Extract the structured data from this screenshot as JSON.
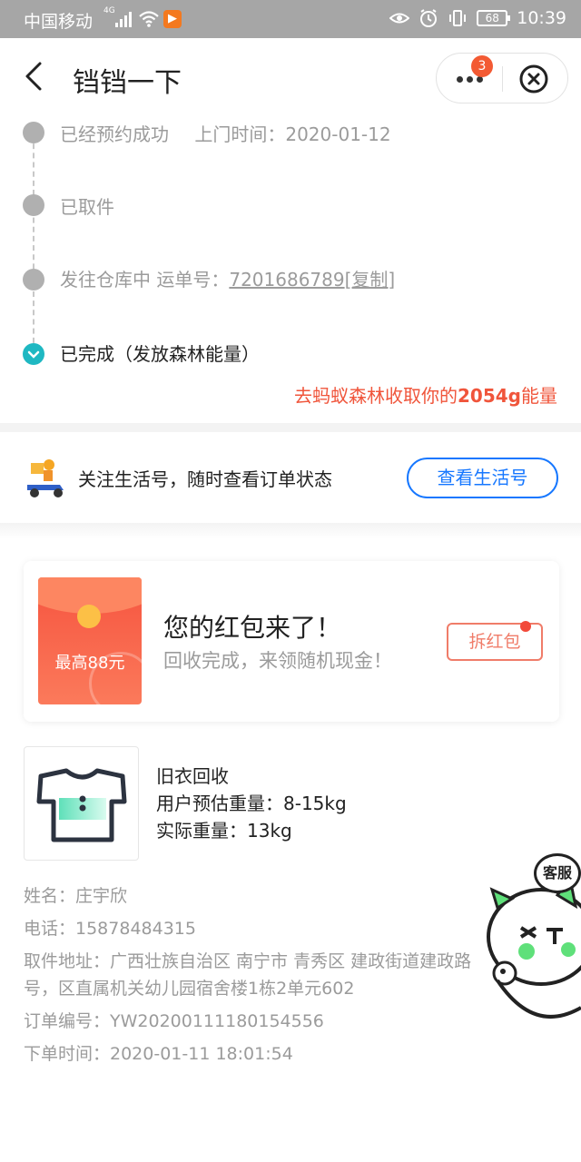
{
  "status_bar": {
    "carrier": "中国移动",
    "network": "4G",
    "battery": "68",
    "time": "10:39"
  },
  "header": {
    "title": "铛铛一下",
    "notification_count": "3"
  },
  "timeline": {
    "steps": [
      {
        "label": "已经预约成功",
        "detail": "上门时间：2020-01-12"
      },
      {
        "label": "已取件"
      },
      {
        "label": "发往仓库中 运单号：",
        "tracking_no": "7201686789",
        "copy_label": "[复制]"
      },
      {
        "label": "已完成（发放森林能量）"
      }
    ],
    "energy_prefix": "去蚂蚁森林收取你的",
    "energy_amount": "2054g",
    "energy_suffix": "能量"
  },
  "follow": {
    "text": "关注生活号，随时查看订单状态",
    "button": "查看生活号"
  },
  "red_packet": {
    "amount_label": "最高88元",
    "title": "您的红包来了！",
    "subtitle": "回收完成，来领随机现金！",
    "button": "拆红包"
  },
  "item": {
    "name": "旧衣回收",
    "estimated": "用户预估重量：8-15kg",
    "actual": "实际重量：13kg"
  },
  "details": {
    "name": "姓名：庄宇欣",
    "phone": "电话：15878484315",
    "address": "取件地址：广西壮族自治区 南宁市 青秀区 建政街道建政路号，区直属机关幼儿园宿舍楼1栋2单元602",
    "order_no": "订单编号：YW20200111180154556",
    "order_time": "下单时间：2020-01-11 18:01:54"
  },
  "customer_service": {
    "label": "客服"
  },
  "colors": {
    "accent_blue": "#1677ff",
    "energy_red": "#f0553b",
    "done_teal": "#1fb8c2"
  }
}
